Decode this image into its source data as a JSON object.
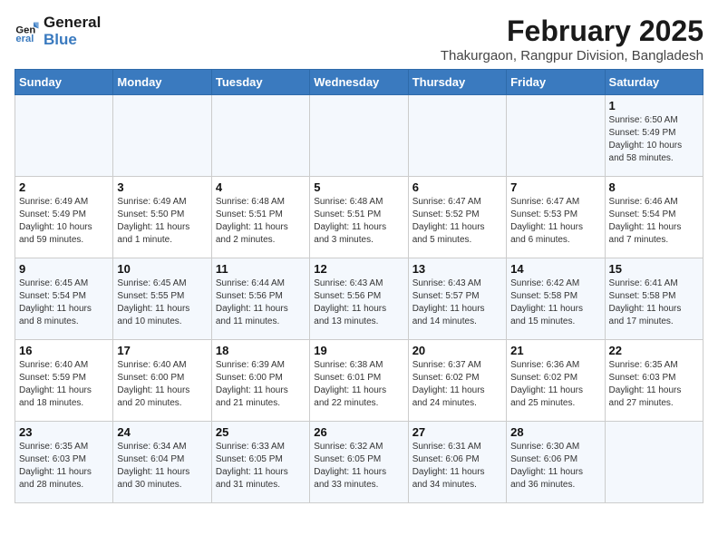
{
  "header": {
    "logo_line1": "General",
    "logo_line2": "Blue",
    "month": "February 2025",
    "location": "Thakurgaon, Rangpur Division, Bangladesh"
  },
  "days_of_week": [
    "Sunday",
    "Monday",
    "Tuesday",
    "Wednesday",
    "Thursday",
    "Friday",
    "Saturday"
  ],
  "weeks": [
    [
      {
        "num": "",
        "info": ""
      },
      {
        "num": "",
        "info": ""
      },
      {
        "num": "",
        "info": ""
      },
      {
        "num": "",
        "info": ""
      },
      {
        "num": "",
        "info": ""
      },
      {
        "num": "",
        "info": ""
      },
      {
        "num": "1",
        "info": "Sunrise: 6:50 AM\nSunset: 5:49 PM\nDaylight: 10 hours\nand 58 minutes."
      }
    ],
    [
      {
        "num": "2",
        "info": "Sunrise: 6:49 AM\nSunset: 5:49 PM\nDaylight: 10 hours\nand 59 minutes."
      },
      {
        "num": "3",
        "info": "Sunrise: 6:49 AM\nSunset: 5:50 PM\nDaylight: 11 hours\nand 1 minute."
      },
      {
        "num": "4",
        "info": "Sunrise: 6:48 AM\nSunset: 5:51 PM\nDaylight: 11 hours\nand 2 minutes."
      },
      {
        "num": "5",
        "info": "Sunrise: 6:48 AM\nSunset: 5:51 PM\nDaylight: 11 hours\nand 3 minutes."
      },
      {
        "num": "6",
        "info": "Sunrise: 6:47 AM\nSunset: 5:52 PM\nDaylight: 11 hours\nand 5 minutes."
      },
      {
        "num": "7",
        "info": "Sunrise: 6:47 AM\nSunset: 5:53 PM\nDaylight: 11 hours\nand 6 minutes."
      },
      {
        "num": "8",
        "info": "Sunrise: 6:46 AM\nSunset: 5:54 PM\nDaylight: 11 hours\nand 7 minutes."
      }
    ],
    [
      {
        "num": "9",
        "info": "Sunrise: 6:45 AM\nSunset: 5:54 PM\nDaylight: 11 hours\nand 8 minutes."
      },
      {
        "num": "10",
        "info": "Sunrise: 6:45 AM\nSunset: 5:55 PM\nDaylight: 11 hours\nand 10 minutes."
      },
      {
        "num": "11",
        "info": "Sunrise: 6:44 AM\nSunset: 5:56 PM\nDaylight: 11 hours\nand 11 minutes."
      },
      {
        "num": "12",
        "info": "Sunrise: 6:43 AM\nSunset: 5:56 PM\nDaylight: 11 hours\nand 13 minutes."
      },
      {
        "num": "13",
        "info": "Sunrise: 6:43 AM\nSunset: 5:57 PM\nDaylight: 11 hours\nand 14 minutes."
      },
      {
        "num": "14",
        "info": "Sunrise: 6:42 AM\nSunset: 5:58 PM\nDaylight: 11 hours\nand 15 minutes."
      },
      {
        "num": "15",
        "info": "Sunrise: 6:41 AM\nSunset: 5:58 PM\nDaylight: 11 hours\nand 17 minutes."
      }
    ],
    [
      {
        "num": "16",
        "info": "Sunrise: 6:40 AM\nSunset: 5:59 PM\nDaylight: 11 hours\nand 18 minutes."
      },
      {
        "num": "17",
        "info": "Sunrise: 6:40 AM\nSunset: 6:00 PM\nDaylight: 11 hours\nand 20 minutes."
      },
      {
        "num": "18",
        "info": "Sunrise: 6:39 AM\nSunset: 6:00 PM\nDaylight: 11 hours\nand 21 minutes."
      },
      {
        "num": "19",
        "info": "Sunrise: 6:38 AM\nSunset: 6:01 PM\nDaylight: 11 hours\nand 22 minutes."
      },
      {
        "num": "20",
        "info": "Sunrise: 6:37 AM\nSunset: 6:02 PM\nDaylight: 11 hours\nand 24 minutes."
      },
      {
        "num": "21",
        "info": "Sunrise: 6:36 AM\nSunset: 6:02 PM\nDaylight: 11 hours\nand 25 minutes."
      },
      {
        "num": "22",
        "info": "Sunrise: 6:35 AM\nSunset: 6:03 PM\nDaylight: 11 hours\nand 27 minutes."
      }
    ],
    [
      {
        "num": "23",
        "info": "Sunrise: 6:35 AM\nSunset: 6:03 PM\nDaylight: 11 hours\nand 28 minutes."
      },
      {
        "num": "24",
        "info": "Sunrise: 6:34 AM\nSunset: 6:04 PM\nDaylight: 11 hours\nand 30 minutes."
      },
      {
        "num": "25",
        "info": "Sunrise: 6:33 AM\nSunset: 6:05 PM\nDaylight: 11 hours\nand 31 minutes."
      },
      {
        "num": "26",
        "info": "Sunrise: 6:32 AM\nSunset: 6:05 PM\nDaylight: 11 hours\nand 33 minutes."
      },
      {
        "num": "27",
        "info": "Sunrise: 6:31 AM\nSunset: 6:06 PM\nDaylight: 11 hours\nand 34 minutes."
      },
      {
        "num": "28",
        "info": "Sunrise: 6:30 AM\nSunset: 6:06 PM\nDaylight: 11 hours\nand 36 minutes."
      },
      {
        "num": "",
        "info": ""
      }
    ]
  ]
}
